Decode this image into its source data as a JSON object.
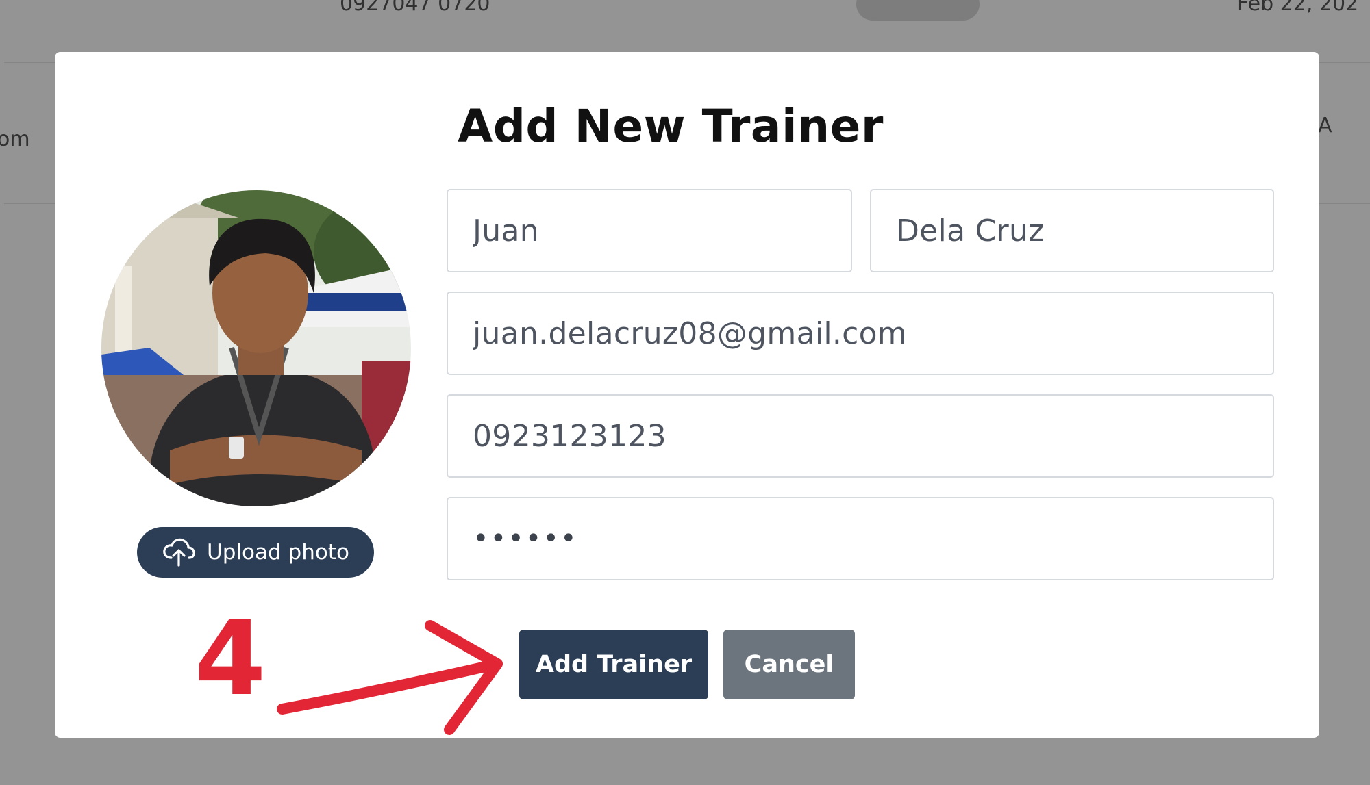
{
  "background": {
    "top_text_left": "0927047 0720",
    "top_text_right": "Feb 22, 202",
    "row_text_left": "om",
    "row_text_right": "A"
  },
  "modal": {
    "title": "Add New Trainer",
    "upload_photo_label": "Upload photo",
    "fields": {
      "first_name": "Juan",
      "last_name": "Dela Cruz",
      "email": "juan.delacruz08@gmail.com",
      "phone": "0923123123",
      "password": "••••••"
    },
    "add_button_label": "Add Trainer",
    "cancel_button_label": "Cancel"
  },
  "annotation": {
    "step_number": "4",
    "color": "#e32636"
  },
  "colors": {
    "primary": "#2c3e56",
    "secondary": "#6c757e",
    "overlay": "rgba(0,0,0,0.42)"
  },
  "icons": {
    "upload": "cloud-upload-icon",
    "arrow": "arrow-right-icon"
  }
}
